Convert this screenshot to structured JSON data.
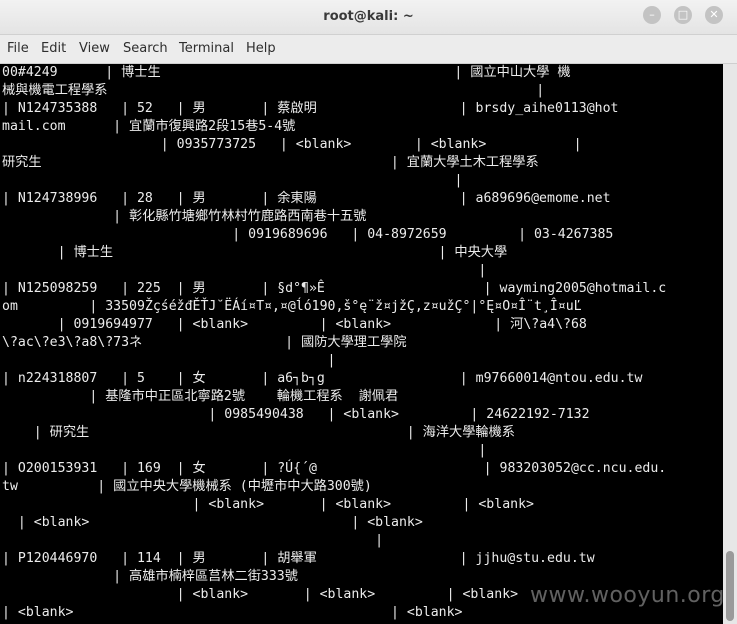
{
  "window": {
    "title": "root@kali: ~"
  },
  "menu": [
    "File",
    "Edit",
    "View",
    "Search",
    "Terminal",
    "Help"
  ],
  "terminal": {
    "lines": [
      "00#4249      | 博士生                                     | 國立中山大學 機",
      "械與機電工程學系                                                      |",
      "| N124735388   | 52   | 男       | 蔡啟明                  | brsdy_aihe0113@hot",
      "mail.com      | 宜蘭市復興路2段15巷5-4號",
      "                    | 0935773725   | <blank>        | <blank>           |",
      "研究生                                            | 宜蘭大學土木工程學系",
      "                                                         |",
      "| N124738996   | 28   | 男       | 余東陽                  | a689696@emome.net",
      "              | 彰化縣竹塘鄉竹林村竹鹿路西南巷十五號",
      "                             | 0919689696   | 04-8972659         | 03-4267385",
      "       | 博士生                                         | 中央大學",
      "                                                            |",
      "| N125098259   | 225  | 男       | §d°¶»Ê                    | wayming2005@hotmail.c",
      "om         | 33509ŽçśéžđĚŤJ˘ËÁí¤T¤,¤@ĺó190,š°ę¨ž¤jžÇ,z¤užÇ°|°Ę¤O¤Î¨t¸Î¤uĽ",
      "       | 0919694977   | <blank>         | <blank>             | 河\\?a4\\?68",
      "\\?ac\\?e3\\?a8\\?73ネ                  | 國防大學理工學院",
      "                                         |",
      "| n224318807   | 5    | 女       | a6┐b┐g                 | m97660014@ntou.edu.tw",
      "           | 基隆市中正區北寧路2號    輪機工程系  謝佩君",
      "                          | 0985490438   | <blank>         | 24622192-7132",
      "    | 研究生                                        | 海洋大學輪機系",
      "                                                            |",
      "| O200153931   | 169  | 女       | ?Ú{´@                     | 983203052@cc.ncu.edu.",
      "tw          | 國立中央大學機械系 (中壢市中大路300號)",
      "                        | <blank>       | <blank>         | <blank>",
      "  | <blank>                                 | <blank>",
      "                                               |",
      "| P120446970   | 114  | 男       | 胡舉軍                  | jjhu@stu.edu.tw",
      "              | 高雄市楠梓區莒林二街333號",
      "                      | <blank>       | <blank>         | <blank>",
      "| <blank>                                        | <blank>"
    ]
  },
  "watermark": "www.wooyun.org"
}
